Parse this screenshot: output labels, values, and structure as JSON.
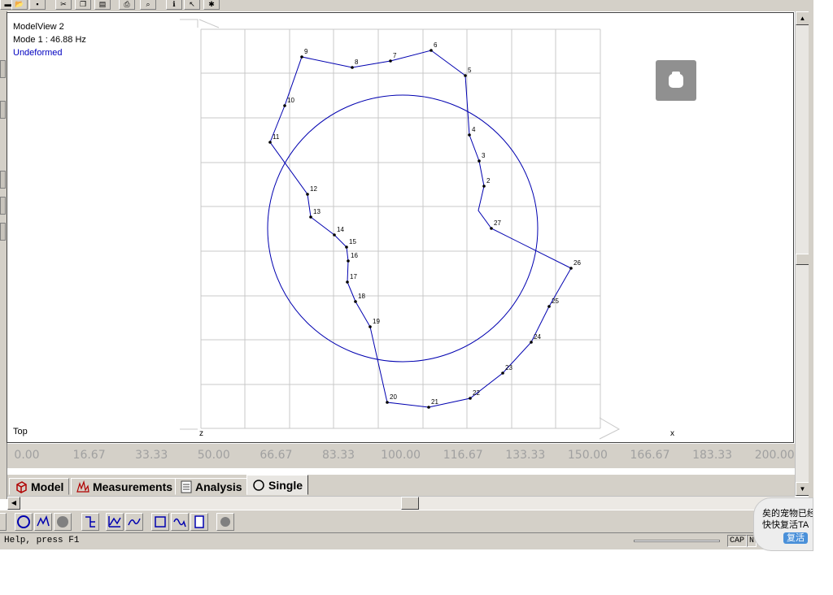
{
  "view": {
    "name": "ModelView 2",
    "mode": "Mode 1 : 46.88 Hz",
    "state": "Undeformed",
    "orientation": "Top",
    "axis_left": "z",
    "axis_right": "x"
  },
  "x_axis": {
    "ticks": [
      "0.00",
      "16.67",
      "33.33",
      "50.00",
      "66.67",
      "83.33",
      "100.00",
      "116.67",
      "133.33",
      "150.00",
      "166.67",
      "183.33",
      "200.00"
    ]
  },
  "nodes": [
    {
      "id": "2"
    },
    {
      "id": "3"
    },
    {
      "id": "4"
    },
    {
      "id": "5"
    },
    {
      "id": "6"
    },
    {
      "id": "7"
    },
    {
      "id": "8"
    },
    {
      "id": "9"
    },
    {
      "id": "10"
    },
    {
      "id": "11"
    },
    {
      "id": "12"
    },
    {
      "id": "13"
    },
    {
      "id": "14"
    },
    {
      "id": "15"
    },
    {
      "id": "16"
    },
    {
      "id": "17"
    },
    {
      "id": "18"
    },
    {
      "id": "19"
    },
    {
      "id": "20"
    },
    {
      "id": "21"
    },
    {
      "id": "22"
    },
    {
      "id": "23"
    },
    {
      "id": "24"
    },
    {
      "id": "25"
    },
    {
      "id": "26"
    },
    {
      "id": "27"
    }
  ],
  "tabs": [
    {
      "label": "Model",
      "icon": "cube-icon"
    },
    {
      "label": "Measurements",
      "icon": "waveform-icon"
    },
    {
      "label": "Analysis",
      "icon": "document-icon"
    },
    {
      "label": "Single",
      "icon": "circle-icon"
    }
  ],
  "status": {
    "help": "Help, press F1",
    "cap": "CAP",
    "num": "N"
  },
  "popup": {
    "line1": "矣的宠物已经",
    "line2": "快快复活TA",
    "button": "复活"
  },
  "colors": {
    "line": "#0000b0",
    "grid": "#c8c8c8",
    "mode_state": "#0000c0",
    "chrome": "#d4d0c8"
  }
}
